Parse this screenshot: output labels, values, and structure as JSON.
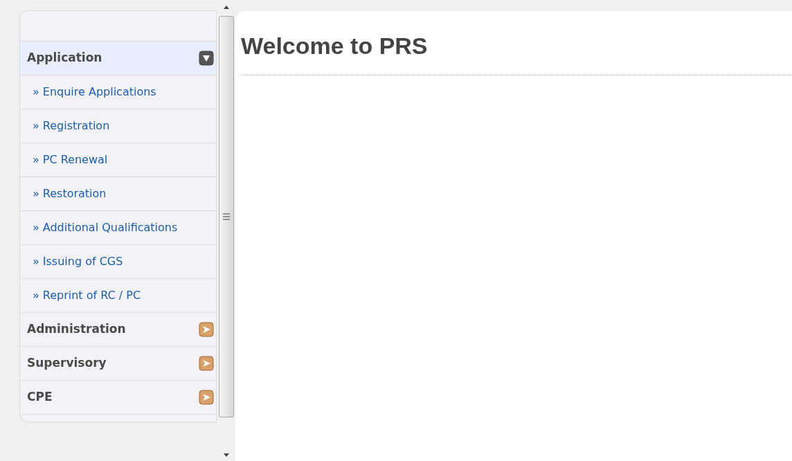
{
  "sidebar": {
    "sections": [
      {
        "label": "Application",
        "expanded": true,
        "selected": true,
        "items": [
          {
            "marker": "»",
            "label": "Enquire Applications"
          },
          {
            "marker": "»",
            "label": "Registration"
          },
          {
            "marker": "»",
            "label": "PC Renewal"
          },
          {
            "marker": "»",
            "label": "Restoration"
          },
          {
            "marker": "»",
            "label": "Additional Qualifications"
          },
          {
            "marker": "»",
            "label": "Issuing of CGS"
          },
          {
            "marker": "»",
            "label": "Reprint of RC / PC"
          }
        ]
      },
      {
        "label": "Administration",
        "expanded": false,
        "selected": false
      },
      {
        "label": "Supervisory",
        "expanded": false,
        "selected": false
      },
      {
        "label": "CPE",
        "expanded": false,
        "selected": false
      }
    ]
  },
  "main": {
    "heading": "Welcome to PRS"
  }
}
